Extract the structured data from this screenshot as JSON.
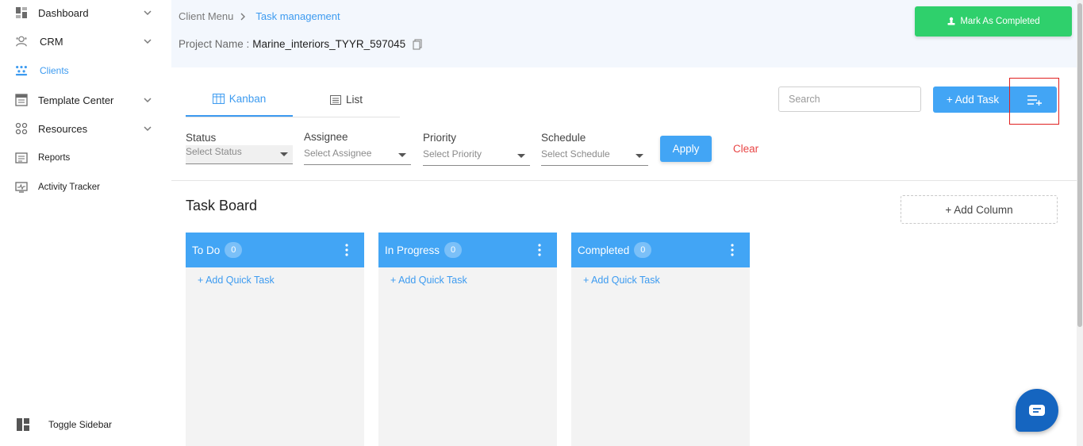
{
  "sidebar": {
    "items": [
      {
        "label": "Dashboard",
        "icon": "dashboard-icon",
        "has_chevron": true
      },
      {
        "label": "CRM",
        "icon": "crm-icon",
        "has_chevron": true
      },
      {
        "label": "Clients",
        "icon": "clients-icon",
        "has_chevron": false,
        "active": true
      },
      {
        "label": "Template Center",
        "icon": "template-icon",
        "has_chevron": true
      },
      {
        "label": "Resources",
        "icon": "resources-icon",
        "has_chevron": true
      },
      {
        "label": "Reports",
        "icon": "reports-icon",
        "has_chevron": false
      },
      {
        "label": "Activity Tracker",
        "icon": "activity-icon",
        "has_chevron": false
      }
    ],
    "toggle_label": "Toggle Sidebar"
  },
  "header": {
    "breadcrumb": [
      "Client Menu",
      "Task management"
    ],
    "project_label": "Project Name :",
    "project_value": "Marine_interiors_TYYR_597045",
    "mark_completed_label": "Mark As Completed"
  },
  "tabs": [
    {
      "label": "Kanban",
      "active": true
    },
    {
      "label": "List",
      "active": false
    }
  ],
  "search": {
    "placeholder": "Search"
  },
  "add_task_label": "+ Add Task",
  "filters": [
    {
      "label": "Status",
      "placeholder": "Select Status"
    },
    {
      "label": "Assignee",
      "placeholder": "Select Assignee"
    },
    {
      "label": "Priority",
      "placeholder": "Select Priority"
    },
    {
      "label": "Schedule",
      "placeholder": "Select Schedule"
    }
  ],
  "apply_label": "Apply",
  "clear_label": "Clear",
  "board": {
    "title": "Task Board",
    "add_column_label": "+ Add Column",
    "columns": [
      {
        "title": "To Do",
        "count": "0",
        "quick_task_label": "+ Add Quick Task"
      },
      {
        "title": "In Progress",
        "count": "0",
        "quick_task_label": "+ Add Quick Task"
      },
      {
        "title": "Completed",
        "count": "0",
        "quick_task_label": "+ Add Quick Task"
      }
    ]
  },
  "colors": {
    "accent": "#42a5f5",
    "success": "#2fd06c",
    "danger": "#e84545",
    "chat": "#1565c0",
    "highlight": "#e02020"
  }
}
